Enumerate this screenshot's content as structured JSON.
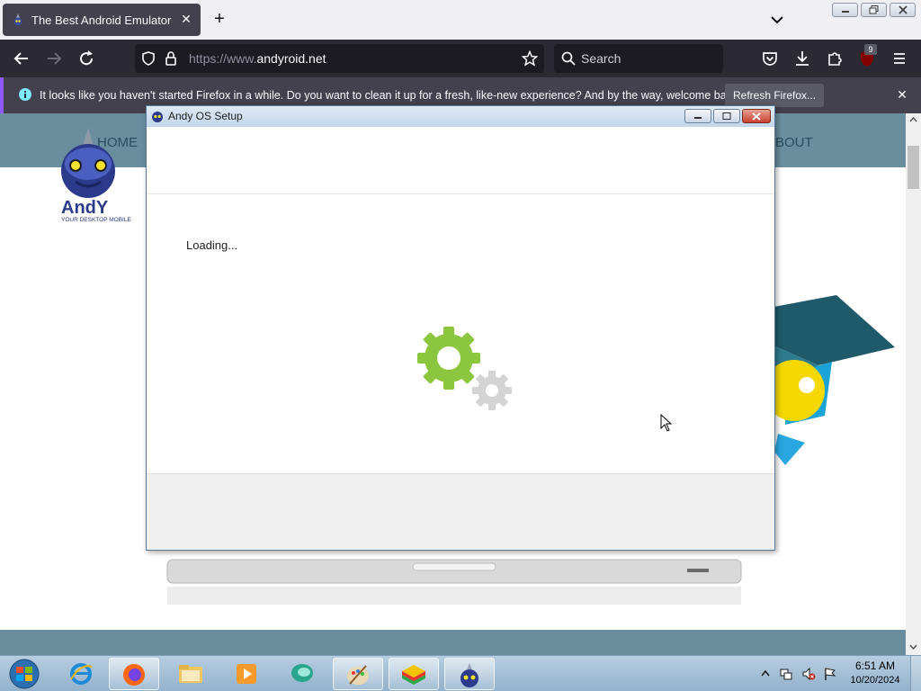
{
  "browser": {
    "tab": {
      "title": "The Best Android Emulator For"
    },
    "url": {
      "scheme": "https://www.",
      "domain": "andyroid.net"
    },
    "search_placeholder": "Search",
    "extension_badge": "9",
    "notification": {
      "message": "It looks like you haven't started Firefox in a while. Do you want to clean it up for a fresh, like-new experience? And by the way, welcome back!",
      "button_label": "Refresh Firefox..."
    }
  },
  "website": {
    "nav_home": "HOME",
    "nav_about": "BOUT",
    "logo_name": "AndY",
    "logo_tagline": "YOUR DESKTOP MOBILE"
  },
  "dialog": {
    "title": "Andy OS Setup",
    "status": "Loading..."
  },
  "taskbar": {
    "time": "6:51 AM",
    "date": "10/20/2024"
  },
  "colors": {
    "gear_large": "#8cc63f",
    "gear_small": "#d4d4d4",
    "site_nav": "#6b8e9f",
    "firefox_dark": "#2b2a33"
  }
}
